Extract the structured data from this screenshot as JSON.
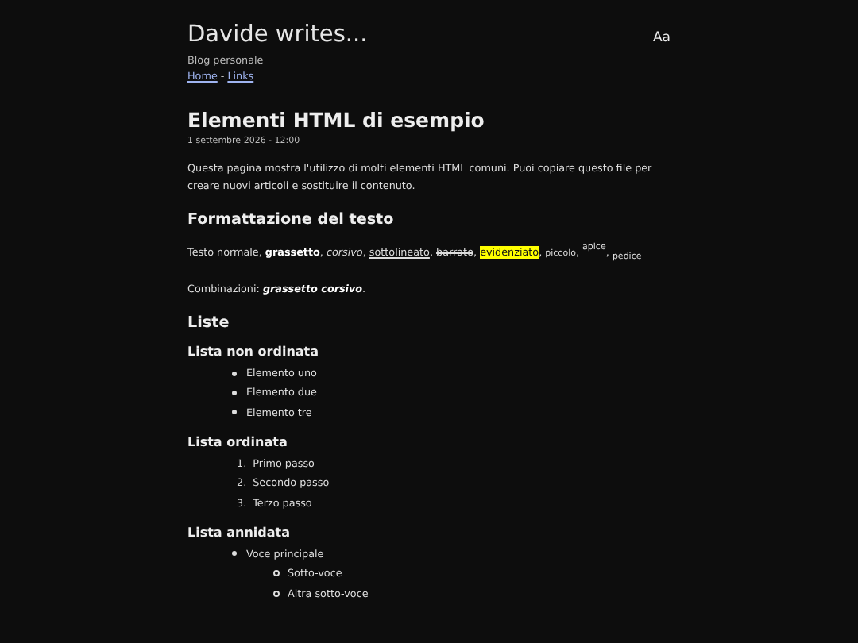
{
  "site": {
    "title": "Davide writes...",
    "subtitle": "Blog personale",
    "nav": [
      "Home",
      "Links"
    ],
    "nav_separator": "-",
    "font_toggle": "Aa"
  },
  "article": {
    "title": "Elementi HTML di esempio",
    "date": "1 settembre 2026 - 12:00",
    "intro": "Questa pagina mostra l'utilizzo di molti elementi HTML comuni. Puoi copiare questo file per creare nuovi articoli e sostituire il contenuto.",
    "sections": [
      {
        "kind": "heading",
        "text": "Formattazione del testo"
      },
      {
        "kind": "styled",
        "segments": [
          {
            "kind": "plain",
            "text": "Testo normale, "
          },
          {
            "kind": "bold",
            "text": "grassetto"
          },
          {
            "kind": "plain",
            "text": ", "
          },
          {
            "kind": "italic",
            "text": "corsivo"
          },
          {
            "kind": "plain",
            "text": ", "
          },
          {
            "kind": "underline",
            "text": "sottolineato"
          },
          {
            "kind": "plain",
            "text": ", "
          },
          {
            "kind": "strike",
            "text": "barrato"
          },
          {
            "kind": "plain",
            "text": ", "
          },
          {
            "kind": "highlight",
            "text": "evidenziato"
          },
          {
            "kind": "plain",
            "text": ", "
          },
          {
            "kind": "small",
            "text": "piccolo"
          },
          {
            "kind": "plain",
            "text": ", "
          },
          {
            "kind": "sup",
            "text": "apice"
          },
          {
            "kind": "plain",
            "text": ", "
          },
          {
            "kind": "sub",
            "text": "pedice"
          }
        ]
      },
      {
        "kind": "styled",
        "segments": [
          {
            "kind": "plain",
            "text": "Combinazioni: "
          },
          {
            "kind": "bolditalic",
            "text": "grassetto corsivo"
          },
          {
            "kind": "plain",
            "text": "."
          }
        ]
      },
      {
        "kind": "heading",
        "text": "Liste"
      },
      {
        "kind": "subheading",
        "text": "Lista non ordinata"
      },
      {
        "kind": "list",
        "items": [
          {
            "text": "Elemento uno"
          },
          {
            "text": "Elemento due"
          },
          {
            "text": "Elemento tre"
          }
        ]
      },
      {
        "kind": "subheading",
        "text": "Lista ordinata"
      },
      {
        "kind": "list",
        "items": [
          {
            "number": "1.",
            "text": "Primo passo"
          },
          {
            "number": "2.",
            "text": "Secondo passo"
          },
          {
            "number": "3.",
            "text": "Terzo passo"
          }
        ]
      },
      {
        "kind": "subheading",
        "text": "Lista annidata"
      },
      {
        "kind": "list",
        "items": [
          {
            "text": "Voce principale",
            "children": [
              {
                "text": "Sotto-voce"
              },
              {
                "text": "Altra sotto-voce"
              }
            ]
          }
        ]
      }
    ]
  }
}
